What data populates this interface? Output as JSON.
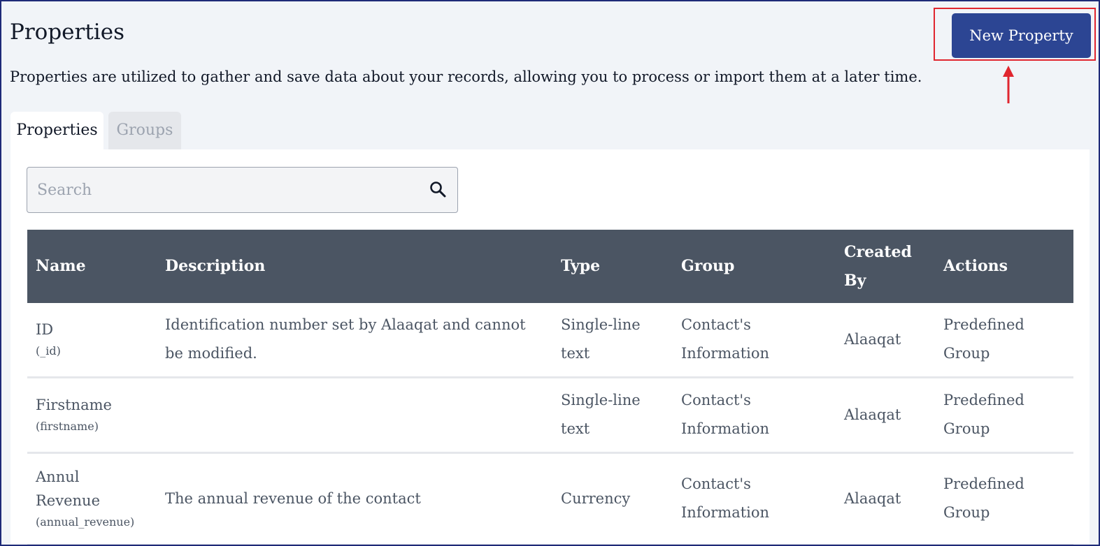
{
  "header": {
    "title": "Properties",
    "description": "Properties are utilized to gather and save data about your records, allowing you to process or import them at a later time.",
    "new_button_label": "New Property"
  },
  "tabs": [
    {
      "label": "Properties",
      "active": true
    },
    {
      "label": "Groups",
      "active": false
    }
  ],
  "search": {
    "placeholder": "Search",
    "value": ""
  },
  "table": {
    "columns": [
      "Name",
      "Description",
      "Type",
      "Group",
      "Created By",
      "Actions"
    ],
    "rows": [
      {
        "name": "ID",
        "key": "(_id)",
        "description": "Identification number set by Alaaqat and cannot be modified.",
        "type": "Single-line text",
        "group": "Contact's Information",
        "created_by": "Alaaqat",
        "actions": "Predefined Group"
      },
      {
        "name": "Firstname",
        "key": "(firstname)",
        "description": "",
        "type": "Single-line text",
        "group": "Contact's Information",
        "created_by": "Alaaqat",
        "actions": "Predefined Group"
      },
      {
        "name": "Annul Revenue",
        "key": "(annual_revenue)",
        "description": "The annual revenue of the contact",
        "type": "Currency",
        "group": "Contact's Information",
        "created_by": "Alaaqat",
        "actions": "Predefined Group"
      }
    ]
  },
  "colors": {
    "primary_button": "#2c4593",
    "table_header": "#4b5563",
    "annotation": "#e0262f",
    "background": "#f1f4f8"
  },
  "icons": {
    "search": "search-icon",
    "annotation_arrow": "arrow-up-icon"
  }
}
